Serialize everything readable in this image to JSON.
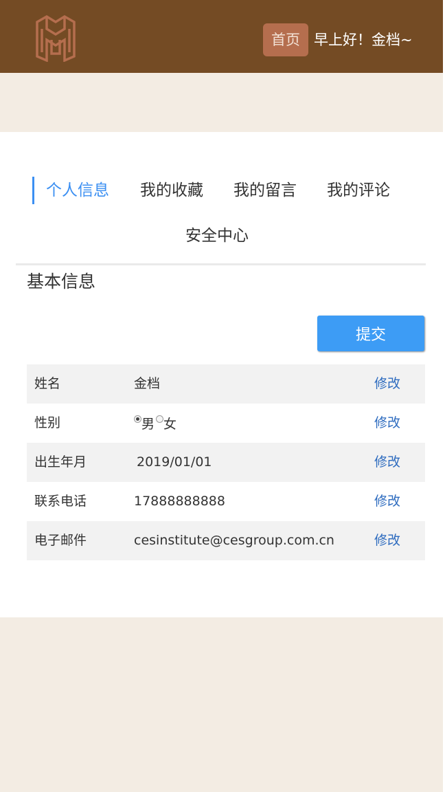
{
  "header": {
    "home_label": "首页",
    "greeting": "早上好！金档~"
  },
  "tabs": [
    {
      "label": "个人信息",
      "active": true
    },
    {
      "label": "我的收藏",
      "active": false
    },
    {
      "label": "我的留言",
      "active": false
    },
    {
      "label": "我的评论",
      "active": false
    },
    {
      "label": "安全中心",
      "active": false
    }
  ],
  "section_title": "基本信息",
  "submit_label": "提交",
  "rows": [
    {
      "label": "姓名",
      "value": "金档",
      "action": "修改"
    },
    {
      "label": "性别",
      "options": [
        "男",
        "女"
      ],
      "selected": "男",
      "action": "修改"
    },
    {
      "label": "出生年月",
      "value": "2019/01/01",
      "action": "修改"
    },
    {
      "label": "联系电话",
      "value": "17888888888",
      "action": "修改"
    },
    {
      "label": "电子邮件",
      "value": "cesinstitute@cesgroup.com.cn",
      "action": "修改"
    }
  ],
  "colors": {
    "header_bg": "#744b24",
    "home_btn_bg": "#b56e4e",
    "accent_blue": "#3b8ff2",
    "submit_blue": "#3d9cf5",
    "action_blue": "#2d6bbf",
    "page_bg": "#f3ece3"
  }
}
